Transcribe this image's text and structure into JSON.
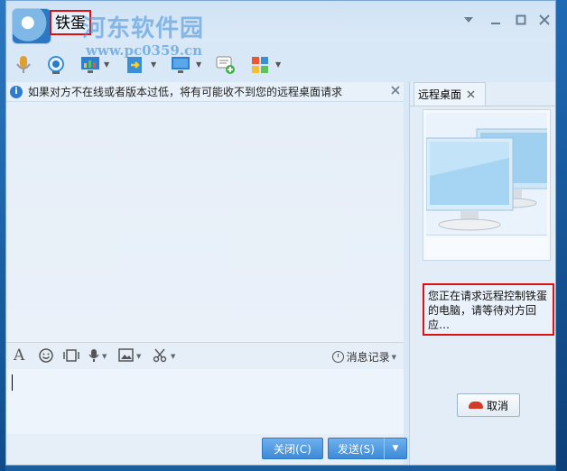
{
  "window": {
    "contact_name": "铁蛋",
    "watermark_text": "河东软件园",
    "watermark_url": "www.pc0359.cn"
  },
  "notice": {
    "text": "如果对方不在线或者版本过低，将有可能收不到您的远程桌面请求"
  },
  "input_toolbar": {
    "history_label": "消息记录"
  },
  "bottom": {
    "close_label": "关闭(C)",
    "send_label": "发送(S)"
  },
  "right_pane": {
    "tab_label": "远程桌面",
    "status_text": "您正在请求远程控制铁蛋的电脑，请等待对方回应…",
    "cancel_label": "取消"
  },
  "colors": {
    "accent": "#3d8ad6",
    "highlight_border": "#dd1111",
    "hangup": "#d23a2a"
  }
}
